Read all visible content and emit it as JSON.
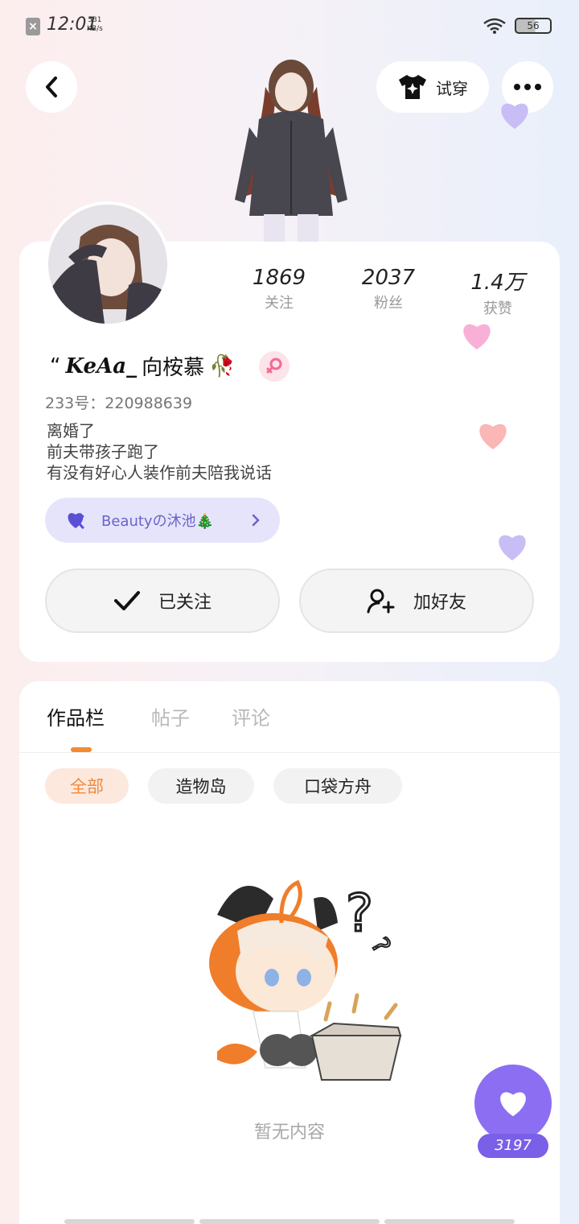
{
  "status_bar": {
    "time": "12:01",
    "net_speed_value": "531",
    "net_speed_unit": "KB/s",
    "battery": "56"
  },
  "nav": {
    "try_on_label": "试穿"
  },
  "stats": [
    {
      "value": "1869",
      "label": "关注"
    },
    {
      "value": "2037",
      "label": "粉丝"
    },
    {
      "value": "1.4万",
      "label": "获赞"
    }
  ],
  "profile": {
    "quote_mark": "“",
    "name_prefix": "KeAa_",
    "name_main": "向桉慕",
    "name_emoji": "🥀",
    "uid": "233号：220988639",
    "bio": [
      "离婚了",
      "前夫带孩子跑了",
      "有没有好心人装作前夫陪我说话"
    ],
    "club_name": "Beautyの沐池🎄"
  },
  "actions": {
    "follow_label": "已关注",
    "add_friend_label": "加好友"
  },
  "tabs": [
    "作品栏",
    "帖子",
    "评论"
  ],
  "filters": [
    "全部",
    "造物岛",
    "口袋方舟"
  ],
  "empty_text": "暂无内容",
  "fab": {
    "count": "3197"
  },
  "colors": {
    "accent_orange": "#f08a3a",
    "accent_purple": "#8c6ef2",
    "club_bg": "#e6e4fb"
  }
}
